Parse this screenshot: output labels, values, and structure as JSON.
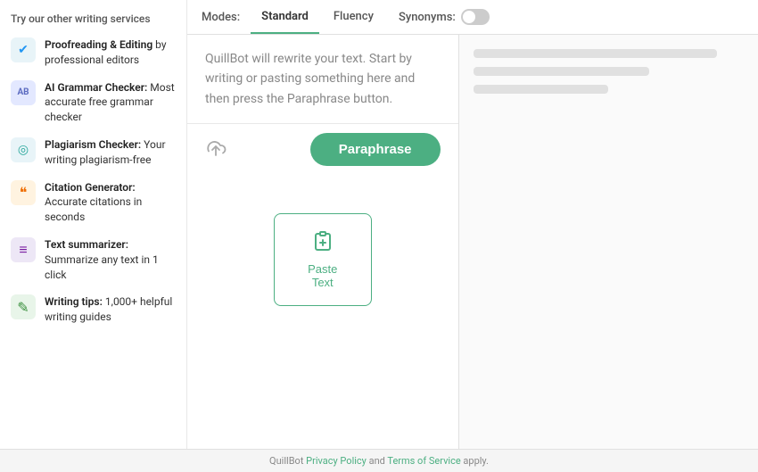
{
  "sidebar": {
    "title": "Try our other writing services",
    "items": [
      {
        "id": "proofreading",
        "icon": "✔",
        "icon_class": "icon-proofreading",
        "label_bold": "Proofreading & Editing",
        "label_rest": " by professional editors"
      },
      {
        "id": "grammar",
        "icon": "AB",
        "icon_class": "icon-grammar",
        "label_bold": "AI Grammar Checker:",
        "label_rest": " Most accurate free grammar checker"
      },
      {
        "id": "plagiarism",
        "icon": "◎",
        "icon_class": "icon-plagiarism",
        "label_bold": "Plagiarism Checker:",
        "label_rest": " Your writing plagiarism-free"
      },
      {
        "id": "citation",
        "icon": "❝",
        "icon_class": "icon-citation",
        "label_bold": "Citation Generator:",
        "label_rest": " Accurate citations in seconds"
      },
      {
        "id": "summarizer",
        "icon": "≡",
        "icon_class": "icon-summarizer",
        "label_bold": "Text summarizer:",
        "label_rest": " Summarize any text in 1 click"
      },
      {
        "id": "tips",
        "icon": "✎",
        "icon_class": "icon-tips",
        "label_bold": "Writing tips:",
        "label_rest": " 1,000+ helpful writing guides"
      }
    ]
  },
  "tabs": {
    "modes_label": "Modes:",
    "items": [
      {
        "id": "standard",
        "label": "Standard",
        "active": true
      },
      {
        "id": "fluency",
        "label": "Fluency",
        "active": false
      }
    ],
    "synonyms_label": "Synonyms:"
  },
  "editor": {
    "placeholder": "QuillBot will rewrite your text. Start by writing or pasting something here and then press the Paraphrase button.",
    "paste_label": "Paste Text"
  },
  "output": {
    "lines": [
      90,
      65,
      50
    ]
  },
  "actions": {
    "paraphrase_label": "Paraphrase",
    "upload_icon": "☁"
  },
  "footer": {
    "text_before": "QuillBot ",
    "privacy_label": "Privacy Policy",
    "text_middle": " and ",
    "terms_label": "Terms of Service",
    "text_after": " apply."
  }
}
